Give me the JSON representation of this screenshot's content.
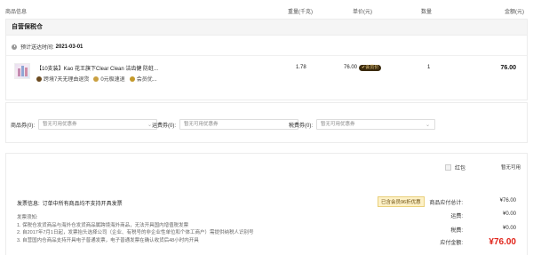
{
  "columns": {
    "product": "商品信息",
    "weight": "重量(千克)",
    "price": "单价(元)",
    "qty": "数量",
    "amount": "金额(元)"
  },
  "store": {
    "title": "自营保税仓",
    "delivery_label": "预计送达时间:",
    "delivery_date": "2021-03-01"
  },
  "product": {
    "name": "【10支装】Kao 花王旗下Clear Clean 洁齿健 防蛀...",
    "tags": [
      "跨境7天无理由退货",
      "0元极速退",
      "会员优..."
    ],
    "weight": "1.78",
    "price": "76.00",
    "vip_badge": "会员价",
    "qty": "1",
    "subtotal": "76.00"
  },
  "coupons": [
    {
      "label": "商品券(0):",
      "value": "暂无可用优惠券"
    },
    {
      "label": "运费券(0):",
      "value": "暂无可用优惠券"
    },
    {
      "label": "税费券(0):",
      "value": "暂无可用优惠券"
    }
  ],
  "redpacket": {
    "label": "红包",
    "status": "暂无可用"
  },
  "invoice": {
    "label": "发票信息:",
    "text": "订单中所有商品均不支持开具发票"
  },
  "notes": {
    "title": "发票须知:",
    "lines": [
      "1. 保税仓发货商品与海外仓发货商品属跨境海外商品，无法开具国内增值税发票",
      "2. 自2017年7月1日起，发票抬头选择公司（企业、有税号的非企业性单位和个体工商户）需提供纳税人识别号",
      "3. 自营国内仓商品支持开具电子普通发票，电子普通发票在确认收货后48小时内开具"
    ]
  },
  "summary": {
    "vip_discount": "已含会员96折优惠",
    "rows": [
      {
        "k": "商品应付总计:",
        "v": "¥76.00"
      },
      {
        "k": "运费:",
        "v": "¥0.00"
      },
      {
        "k": "税费:",
        "v": "¥0.00"
      }
    ],
    "total_label": "应付金额:",
    "total_value": "¥76.00"
  },
  "colors": {
    "accent_red": "#e1251b",
    "vip_gold": "#f5d58a"
  }
}
